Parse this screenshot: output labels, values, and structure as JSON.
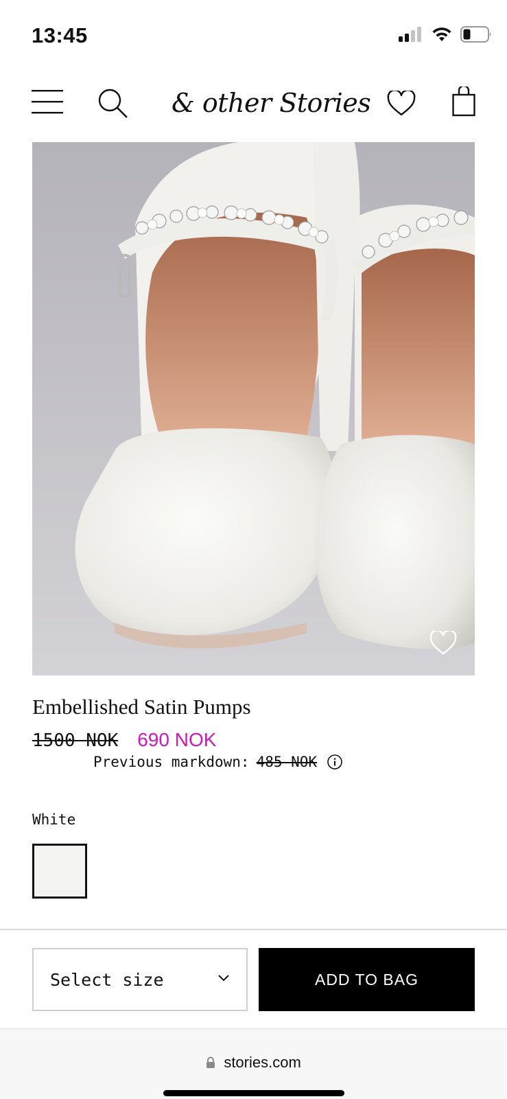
{
  "status_bar": {
    "time": "13:45",
    "signal_icon": "signal-icon",
    "wifi_icon": "wifi-icon",
    "battery_icon": "battery-icon"
  },
  "header": {
    "logo_text": "& other Stories",
    "menu_icon": "hamburger-menu-icon",
    "search_icon": "search-icon",
    "wishlist_icon": "heart-icon",
    "bag_icon": "shopping-bag-icon"
  },
  "product": {
    "image_alt": "Embellished Satin Pumps",
    "favorite_icon": "heart-icon",
    "title": "Embellished Satin Pumps",
    "original_price": "1500 NOK",
    "sale_price": "690 NOK",
    "markdown_label": "Previous markdown:",
    "markdown_price": "485 NOK",
    "info_icon": "info-icon",
    "color_name": "White",
    "swatch_color": "#f3f3f1"
  },
  "purchase": {
    "size_select_label": "Select size",
    "chevron_icon": "chevron-down-icon",
    "add_to_bag_label": "ADD TO BAG"
  },
  "browser": {
    "url": "stories.com",
    "lock_icon": "lock-icon"
  },
  "colors": {
    "sale": "#d118b9",
    "button_bg": "#000000",
    "text": "#111111"
  }
}
